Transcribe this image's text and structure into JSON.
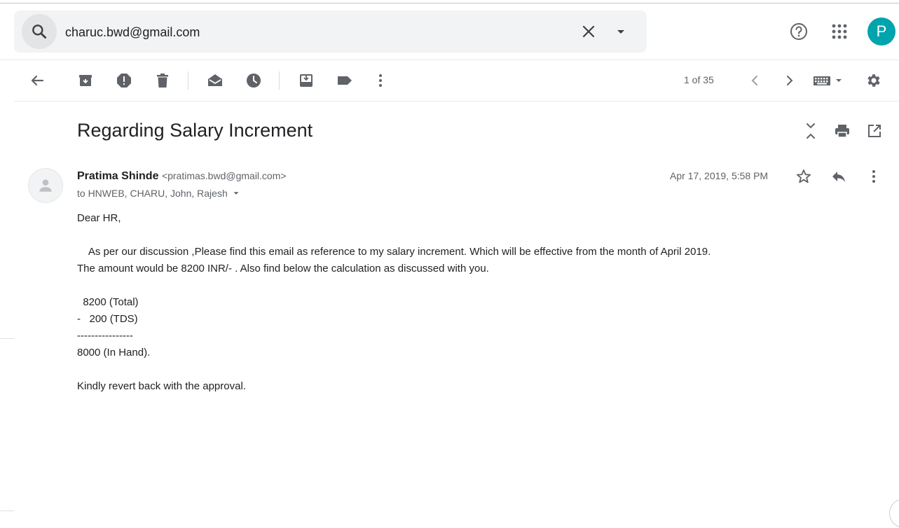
{
  "search": {
    "value": "charuc.bwd@gmail.com"
  },
  "header": {
    "avatar_initial": "P"
  },
  "toolbar": {
    "pager": "1 of 35"
  },
  "email": {
    "subject": "Regarding Salary Increment",
    "sender_name": "Pratima Shinde",
    "sender_email": "<pratimas.bwd@gmail.com>",
    "recipients": "to HNWEB, CHARU, John, Rajesh",
    "date": "Apr 17, 2019, 5:58 PM",
    "body": [
      "Dear HR,",
      "    As per our discussion ,Please find this email as reference to my salary increment. Which will be effective from the month of April 2019.",
      "The amount would be 8200 INR/- . Also find below the calculation as discussed with you.",
      "  8200 (Total)",
      "-   200 (TDS)",
      "----------------",
      "8000 (In Hand).",
      "Kindly revert back with the approval."
    ]
  },
  "icons": {
    "color": "#5f6368",
    "brand_color": "#00a4ad"
  }
}
